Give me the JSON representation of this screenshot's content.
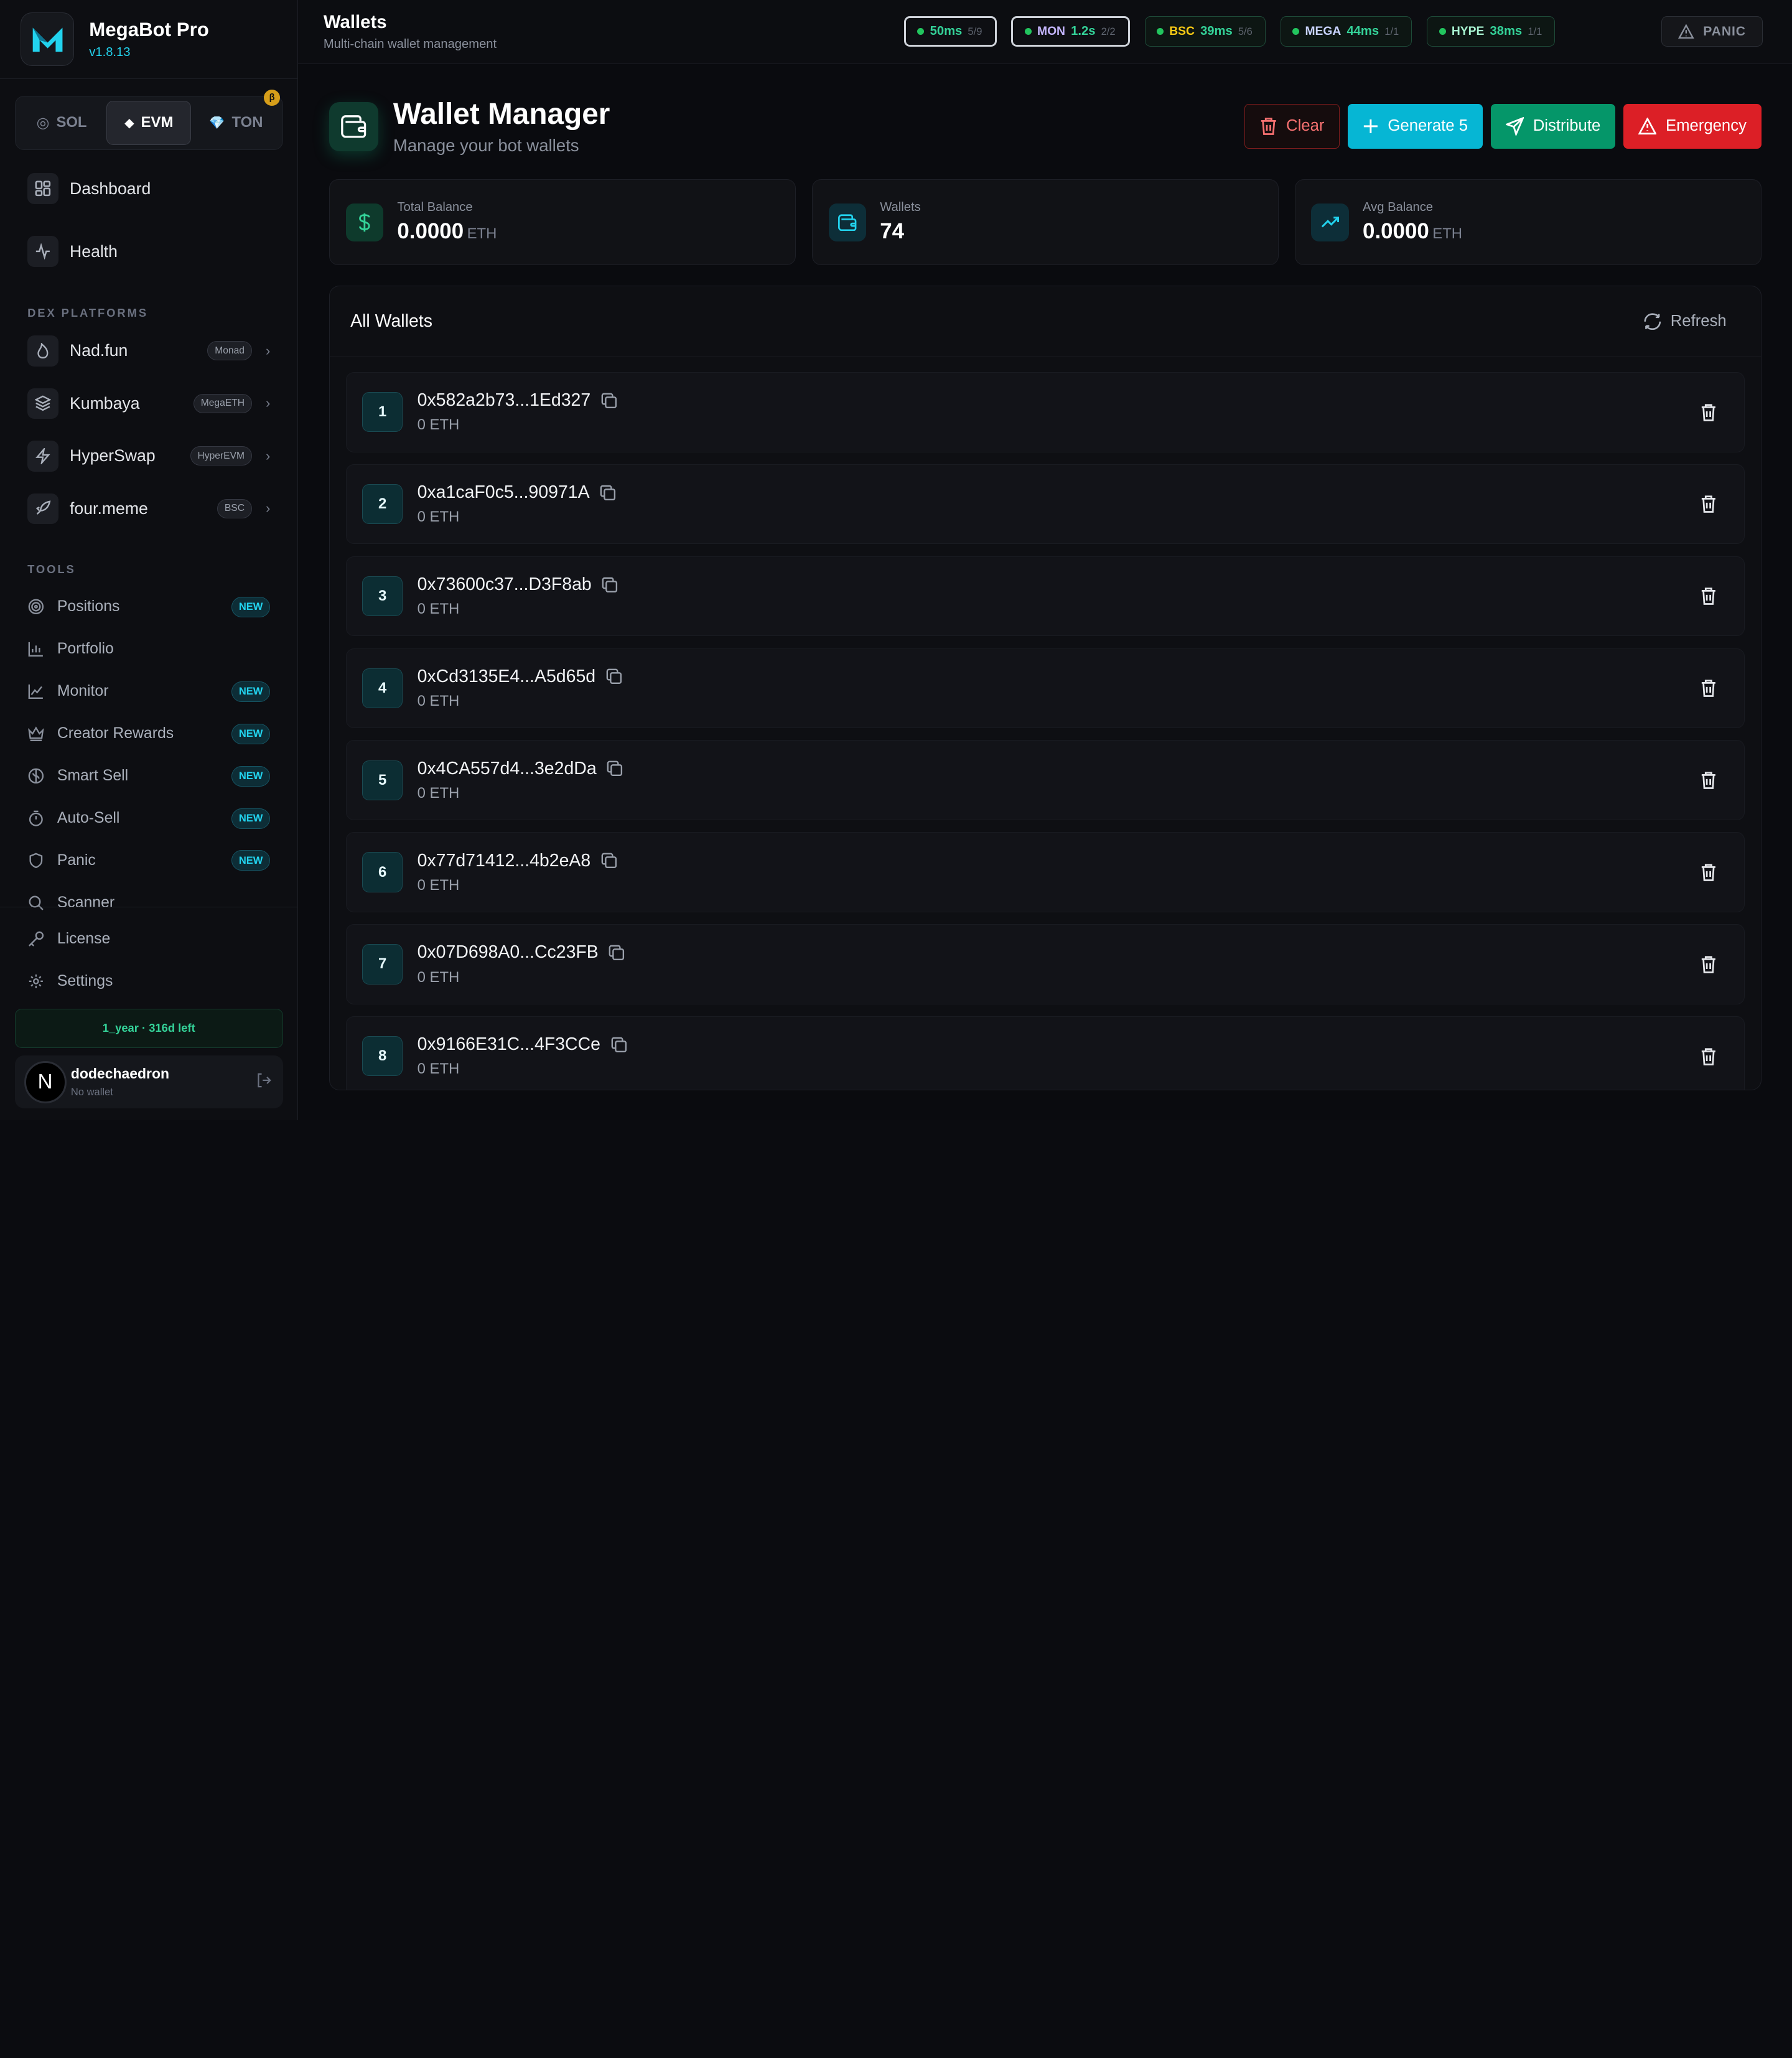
{
  "brand": {
    "name": "MegaBot Pro",
    "version": "v1.8.13",
    "beta": "β"
  },
  "chains": [
    {
      "label": "SOL",
      "icon": "◎",
      "active": false
    },
    {
      "label": "EVM",
      "icon": "◆",
      "active": true
    },
    {
      "label": "TON",
      "icon": "💎",
      "active": false
    }
  ],
  "nav": {
    "dashboard": "Dashboard",
    "health": "Health"
  },
  "dex": {
    "title": "DEX PLATFORMS",
    "items": [
      {
        "label": "Nad.fun",
        "tag": "Monad"
      },
      {
        "label": "Kumbaya",
        "tag": "MegaETH"
      },
      {
        "label": "HyperSwap",
        "tag": "HyperEVM"
      },
      {
        "label": "four.meme",
        "tag": "BSC"
      }
    ]
  },
  "tools": {
    "title": "TOOLS",
    "items": [
      {
        "label": "Positions",
        "badge": "NEW"
      },
      {
        "label": "Portfolio",
        "badge": ""
      },
      {
        "label": "Monitor",
        "badge": "NEW"
      },
      {
        "label": "Creator Rewards",
        "badge": "NEW"
      },
      {
        "label": "Smart Sell",
        "badge": "NEW"
      },
      {
        "label": "Auto-Sell",
        "badge": "NEW"
      },
      {
        "label": "Panic",
        "badge": "NEW"
      },
      {
        "label": "Scanner",
        "badge": ""
      }
    ]
  },
  "bottom_nav": {
    "license": "License",
    "settings": "Settings"
  },
  "license_status": "1_year · 316d left",
  "user": {
    "initial": "N",
    "name": "dodechaedron",
    "sub": "No wallet"
  },
  "topbar": {
    "title": "Wallets",
    "subtitle": "Multi-chain wallet management"
  },
  "status_pills": [
    {
      "name": "",
      "ms": "50ms",
      "count": "5/9",
      "name_color": "#ffffff"
    },
    {
      "name": "MON",
      "ms": "1.2s",
      "count": "2/2",
      "name_color": "#c4b5fd"
    },
    {
      "name": "BSC",
      "ms": "39ms",
      "count": "5/6",
      "name_color": "#facc15"
    },
    {
      "name": "MEGA",
      "ms": "44ms",
      "count": "1/1",
      "name_color": "#c7d2fe"
    },
    {
      "name": "HYPE",
      "ms": "38ms",
      "count": "1/1",
      "name_color": "#a7f3d0"
    }
  ],
  "panic": "PANIC",
  "page": {
    "title": "Wallet Manager",
    "subtitle": "Manage your bot wallets"
  },
  "actions": {
    "clear": "Clear",
    "generate": "Generate 5",
    "distribute": "Distribute",
    "emergency": "Emergency"
  },
  "stats": [
    {
      "label": "Total Balance",
      "value": "0.0000",
      "unit": "ETH"
    },
    {
      "label": "Wallets",
      "value": "74",
      "unit": ""
    },
    {
      "label": "Avg Balance",
      "value": "0.0000",
      "unit": "ETH"
    }
  ],
  "wallets_panel": {
    "title": "All Wallets",
    "refresh": "Refresh"
  },
  "wallets": [
    {
      "index": "1",
      "address": "0x582a2b73...1Ed327",
      "balance": "0 ETH"
    },
    {
      "index": "2",
      "address": "0xa1caF0c5...90971A",
      "balance": "0 ETH"
    },
    {
      "index": "3",
      "address": "0x73600c37...D3F8ab",
      "balance": "0 ETH"
    },
    {
      "index": "4",
      "address": "0xCd3135E4...A5d65d",
      "balance": "0 ETH"
    },
    {
      "index": "5",
      "address": "0x4CA557d4...3e2dDa",
      "balance": "0 ETH"
    },
    {
      "index": "6",
      "address": "0x77d71412...4b2eA8",
      "balance": "0 ETH"
    },
    {
      "index": "7",
      "address": "0x07D698A0...Cc23FB",
      "balance": "0 ETH"
    },
    {
      "index": "8",
      "address": "0x9166E31C...4F3CCe",
      "balance": "0 ETH"
    }
  ],
  "colors": {
    "accent": "#22d3ee",
    "green": "#10b981",
    "red": "#dc1f26"
  }
}
